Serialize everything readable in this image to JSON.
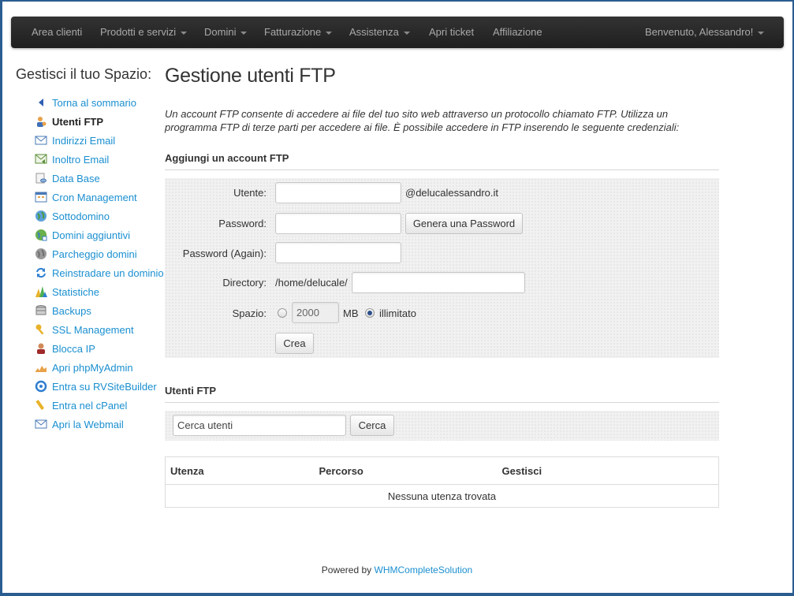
{
  "navbar": {
    "items": [
      {
        "label": "Area clienti",
        "dropdown": false
      },
      {
        "label": "Prodotti e servizi",
        "dropdown": true
      },
      {
        "label": "Domini",
        "dropdown": true
      },
      {
        "label": "Fatturazione",
        "dropdown": true
      },
      {
        "label": "Assistenza",
        "dropdown": true
      },
      {
        "label": "Apri ticket",
        "dropdown": false
      },
      {
        "label": "Affiliazione",
        "dropdown": false
      }
    ],
    "user": "Benvenuto, Alessandro!"
  },
  "sidebar": {
    "title": "Gestisci il tuo Spazio:",
    "items": [
      {
        "label": "Torna al sommario",
        "icon": "back-arrow-icon"
      },
      {
        "label": "Utenti FTP",
        "icon": "ftp-users-icon",
        "active": true
      },
      {
        "label": "Indirizzi Email",
        "icon": "email-icon"
      },
      {
        "label": "Inoltro Email",
        "icon": "email-forward-icon"
      },
      {
        "label": "Data Base",
        "icon": "database-icon"
      },
      {
        "label": "Cron Management",
        "icon": "calendar-icon"
      },
      {
        "label": "Sottodomino",
        "icon": "globe-icon"
      },
      {
        "label": "Domini aggiuntivi",
        "icon": "globe-add-icon"
      },
      {
        "label": "Parcheggio domini",
        "icon": "parked-globe-icon"
      },
      {
        "label": "Reinstradare un dominio",
        "icon": "redirect-icon"
      },
      {
        "label": "Statistiche",
        "icon": "stats-icon"
      },
      {
        "label": "Backups",
        "icon": "backup-icon"
      },
      {
        "label": "SSL Management",
        "icon": "ssl-key-icon"
      },
      {
        "label": "Blocca IP",
        "icon": "block-ip-icon"
      },
      {
        "label": "Apri phpMyAdmin",
        "icon": "phpmyadmin-icon"
      },
      {
        "label": "Entra su RVSiteBuilder",
        "icon": "sitebuilder-icon"
      },
      {
        "label": "Entra nel cPanel",
        "icon": "cpanel-icon"
      },
      {
        "label": "Apri la Webmail",
        "icon": "webmail-icon"
      }
    ]
  },
  "main": {
    "title": "Gestione utenti FTP",
    "intro": "Un account FTP consente di accedere ai file del tuo sito web attraverso un protocollo chiamato FTP. Utilizza un programma FTP di terze parti per accedere ai file. È possibile accedere in FTP inserendo le seguente credenziali:",
    "add_section": {
      "heading": "Aggiungi un account FTP",
      "user_label": "Utente:",
      "user_value": "",
      "domain_suffix": "@delucalessandro.it",
      "password_label": "Password:",
      "password_value": "",
      "generate_button": "Genera una Password",
      "password_again_label": "Password (Again):",
      "password_again_value": "",
      "directory_label": "Directory:",
      "directory_prefix": "/home/delucale/",
      "directory_value": "",
      "space_label": "Spazio:",
      "space_value": "2000",
      "space_unit": "MB",
      "unlimited_label": "illimitato",
      "unlimited_selected": true,
      "create_button": "Crea"
    },
    "users_section": {
      "heading": "Utenti FTP",
      "search_placeholder": "Cerca utenti",
      "search_button": "Cerca",
      "columns": [
        "Utenza",
        "Percorso",
        "Gestisci"
      ],
      "empty_message": "Nessuna utenza trovata"
    }
  },
  "footer": {
    "prefix": "Powered by",
    "link": "WHMCompleteSolution"
  }
}
